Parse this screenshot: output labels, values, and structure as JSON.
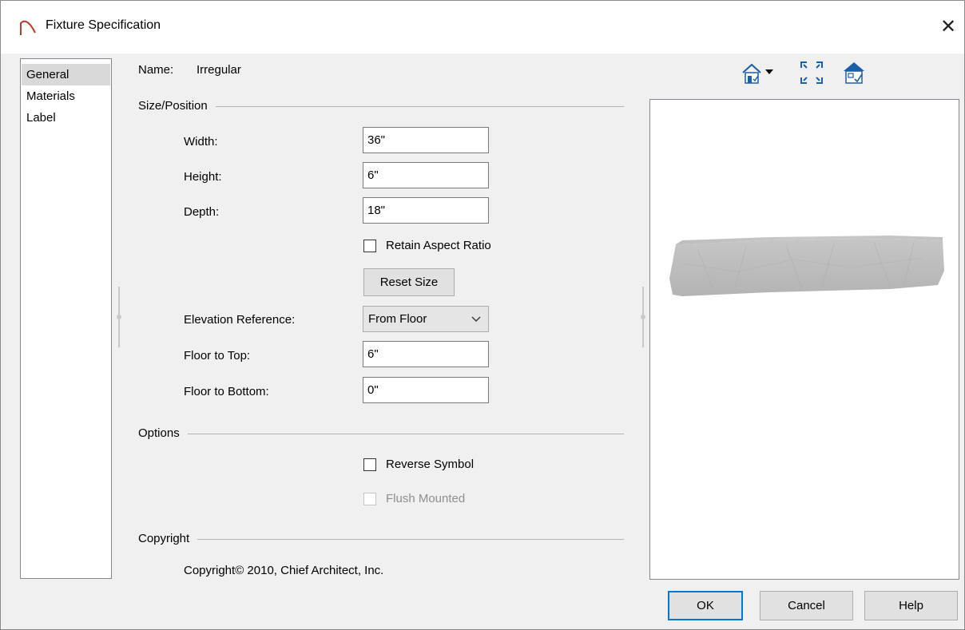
{
  "window": {
    "title": "Fixture Specification",
    "close_glyph": "✕"
  },
  "nav": {
    "items": [
      "General",
      "Materials",
      "Label"
    ],
    "selected": "General"
  },
  "general": {
    "name_label": "Name:",
    "name_value": "Irregular",
    "size_position": {
      "title": "Size/Position",
      "width_label": "Width:",
      "width_value": "36\"",
      "height_label": "Height:",
      "height_value": "6\"",
      "depth_label": "Depth:",
      "depth_value": "18\"",
      "retain_aspect_label": "Retain Aspect Ratio",
      "retain_aspect_checked": false,
      "reset_size_label": "Reset Size",
      "elevation_ref_label": "Elevation Reference:",
      "elevation_ref_value": "From Floor",
      "floor_to_top_label": "Floor to Top:",
      "floor_to_top_value": "6\"",
      "floor_to_bottom_label": "Floor to Bottom:",
      "floor_to_bottom_value": "0\""
    },
    "options": {
      "title": "Options",
      "reverse_symbol_label": "Reverse Symbol",
      "reverse_symbol_checked": false,
      "flush_mounted_label": "Flush Mounted",
      "flush_mounted_checked": false,
      "flush_mounted_enabled": false
    },
    "copyright": {
      "title": "Copyright",
      "text": "Copyright© 2010, Chief Architect, Inc."
    }
  },
  "preview_toolbar": {
    "icons": [
      "camera-view-icon",
      "fill-window-icon",
      "preview-options-icon"
    ]
  },
  "buttons": {
    "ok": "OK",
    "cancel": "Cancel",
    "help": "Help"
  },
  "colors": {
    "accent": "#0078d7",
    "dialog_bg": "#f0f0f0",
    "title_icon": "#c0392b"
  }
}
